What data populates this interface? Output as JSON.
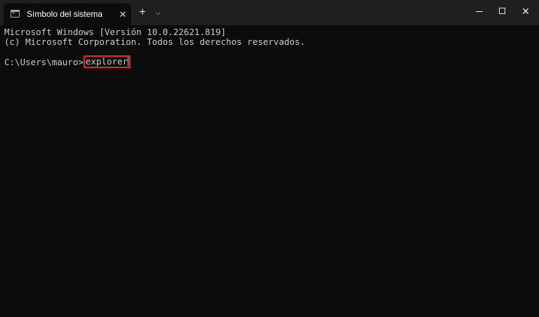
{
  "window": {
    "tab_title": "Símbolo del sistema",
    "tab_close_glyph": "✕",
    "new_tab_glyph": "+",
    "dropdown_glyph": "⌵",
    "close_glyph": "✕"
  },
  "terminal": {
    "lines": [
      "Microsoft Windows [Versión 10.0.22621.819]",
      "(c) Microsoft Corporation. Todos los derechos reservados."
    ],
    "prompt": "C:\\Users\\mauro>",
    "command": "explorer"
  },
  "colors": {
    "terminal_bg": "#0c0c0c",
    "titlebar_bg": "#1f1f1f",
    "text": "#cccccc",
    "highlight_box": "#e0262b"
  },
  "icons": {
    "tab_icon": "terminal-icon",
    "minimize": "minimize-icon",
    "maximize": "maximize-icon",
    "close": "close-icon"
  }
}
